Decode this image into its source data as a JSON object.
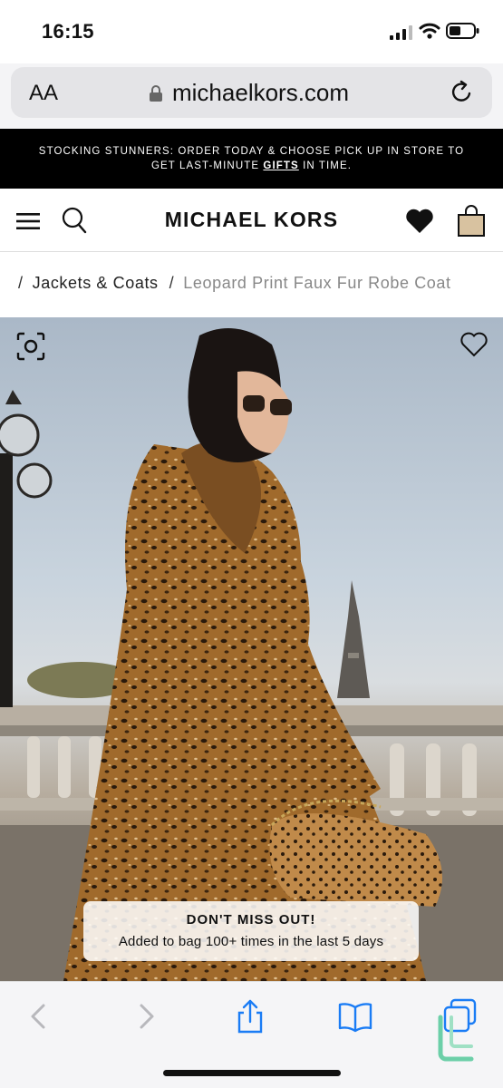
{
  "status": {
    "time": "16:15"
  },
  "browser": {
    "text_size_label": "AA",
    "domain": "michaelkors.com"
  },
  "promo": {
    "line1": "STOCKING STUNNERS: ORDER TODAY & CHOOSE PICK UP IN STORE TO",
    "line2_pre": "GET LAST-MINUTE ",
    "line2_link": "GIFTS",
    "line2_post": " IN TIME."
  },
  "header": {
    "brand": "MICHAEL KORS"
  },
  "breadcrumb": {
    "separator": "/",
    "items": [
      {
        "label": "Jackets & Coats"
      },
      {
        "label": "Leopard Print Faux Fur Robe Coat"
      }
    ]
  },
  "toast": {
    "title": "DON'T MISS OUT!",
    "message": "Added to bag 100+ times in the last 5 days"
  },
  "icons": {
    "menu": "hamburger-icon",
    "search": "search-icon",
    "wishlist": "heart-icon",
    "bag": "shopping-bag-icon",
    "zoom": "visual-search-icon",
    "share": "share-icon",
    "bookmarks": "book-icon",
    "tabs": "tabs-icon"
  },
  "colors": {
    "banner_bg": "#000000",
    "accent_blue": "#1a7cf5"
  }
}
